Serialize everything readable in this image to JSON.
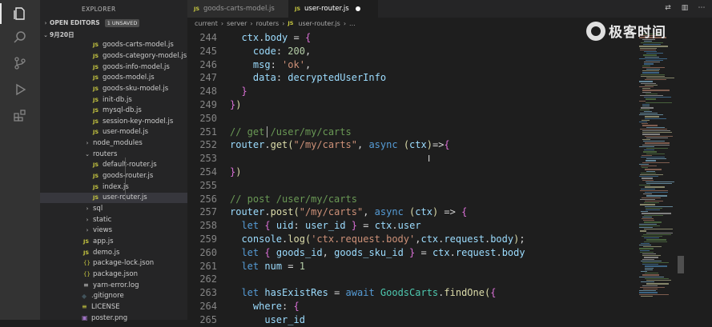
{
  "explorer": {
    "title": "EXPLORER",
    "more": "···",
    "open_editors_label": "OPEN EDITORS",
    "unsaved_badge": "1 UNSAVED",
    "folder_label": "9月20日"
  },
  "tree": [
    {
      "name": "goods-carts-model.js",
      "icon": "JS"
    },
    {
      "name": "goods-category-model.js",
      "icon": "JS"
    },
    {
      "name": "goods-info-model.js",
      "icon": "JS"
    },
    {
      "name": "goods-model.js",
      "icon": "JS"
    },
    {
      "name": "goods-sku-model.js",
      "icon": "JS"
    },
    {
      "name": "init-db.js",
      "icon": "JS"
    },
    {
      "name": "mysql-db.js",
      "icon": "JS"
    },
    {
      "name": "session-key-model.js",
      "icon": "JS"
    },
    {
      "name": "user-model.js",
      "icon": "JS"
    },
    {
      "name": "node_modules",
      "icon": ">"
    },
    {
      "name": "routers",
      "icon": "v"
    },
    {
      "name": "default-router.js",
      "icon": "JS"
    },
    {
      "name": "goods-router.js",
      "icon": "JS"
    },
    {
      "name": "index.js",
      "icon": "JS"
    },
    {
      "name": "user-router.js",
      "icon": "JS"
    },
    {
      "name": "sql",
      "icon": ">"
    },
    {
      "name": "static",
      "icon": ">"
    },
    {
      "name": "views",
      "icon": ">"
    },
    {
      "name": "app.js",
      "icon": "JS"
    },
    {
      "name": "demo.js",
      "icon": "JS"
    },
    {
      "name": "package-lock.json",
      "icon": "{}"
    },
    {
      "name": "package.json",
      "icon": "{}"
    },
    {
      "name": "yarn-error.log",
      "icon": "≡"
    },
    {
      "name": ".gitignore",
      "icon": "◆"
    },
    {
      "name": "LICENSE",
      "icon": "≡"
    },
    {
      "name": "poster.png",
      "icon": "▣"
    }
  ],
  "tabs": [
    {
      "label": "goods-carts-model.js",
      "icon": "JS"
    },
    {
      "label": "user-router.js",
      "icon": "JS"
    }
  ],
  "breadcrumb": [
    "current",
    "server",
    "routers",
    "user-router.js",
    "..."
  ],
  "code": [
    {
      "n": "244",
      "t": "  ctx.body = {"
    },
    {
      "n": "245",
      "t": "    code: 200,"
    },
    {
      "n": "246",
      "t": "    msg: 'ok',"
    },
    {
      "n": "247",
      "t": "    data: decryptedUserInfo"
    },
    {
      "n": "248",
      "t": "  }"
    },
    {
      "n": "249",
      "t": "})"
    },
    {
      "n": "250",
      "t": ""
    },
    {
      "n": "251",
      "t": "// get /user/my/carts"
    },
    {
      "n": "252",
      "t": "router.get(\"/my/carts\", async (ctx)=>{"
    },
    {
      "n": "253",
      "t": ""
    },
    {
      "n": "254",
      "t": "})"
    },
    {
      "n": "255",
      "t": ""
    },
    {
      "n": "256",
      "t": "// post /user/my/carts"
    },
    {
      "n": "257",
      "t": "router.post(\"/my/carts\", async (ctx) => {"
    },
    {
      "n": "258",
      "t": "  let { uid: user_id } = ctx.user"
    },
    {
      "n": "259",
      "t": "  console.log('ctx.request.body',ctx.request.body);"
    },
    {
      "n": "260",
      "t": "  let { goods_id, goods_sku_id } = ctx.request.body"
    },
    {
      "n": "261",
      "t": "  let num = 1"
    },
    {
      "n": "262",
      "t": ""
    },
    {
      "n": "263",
      "t": "  let hasExistRes = await GoodsCarts.findOne({"
    },
    {
      "n": "264",
      "t": "    where: {"
    },
    {
      "n": "265",
      "t": "      user_id"
    }
  ],
  "watermark": {
    "text": "极客时间"
  },
  "colors": {
    "accent": "#007acc",
    "keyword": "#569cd6",
    "string": "#ce9178",
    "number": "#b5cea8",
    "comment": "#6a9955",
    "function": "#dcdcaa",
    "class": "#4ec9b0",
    "variable": "#9cdcfe"
  }
}
